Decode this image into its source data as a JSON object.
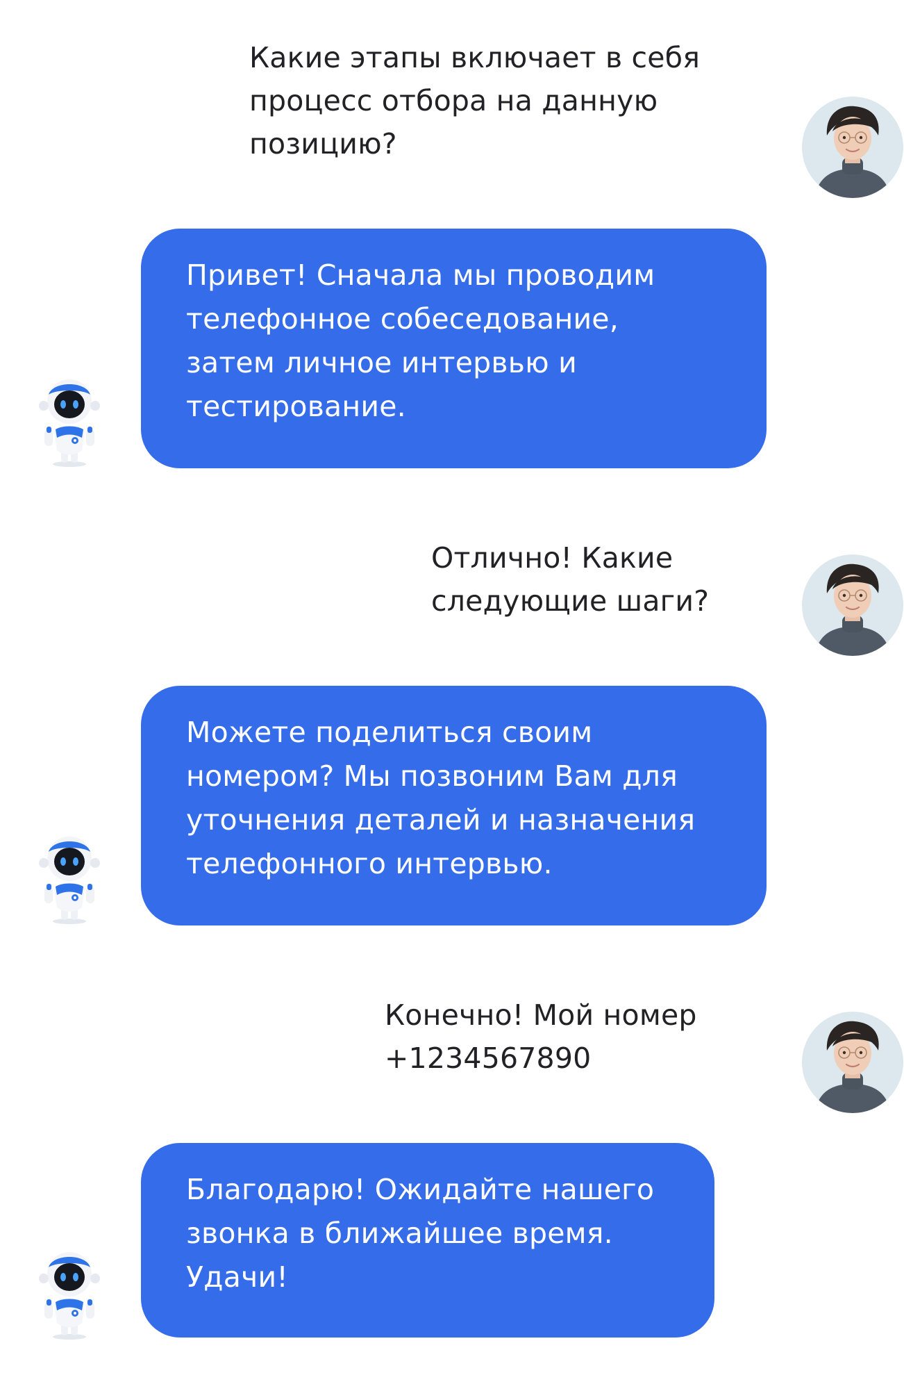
{
  "messages": [
    {
      "sender": "user",
      "text": "Какие этапы включает в себя\nпроцесс отбора на данную\nпозицию?"
    },
    {
      "sender": "bot",
      "text": "Привет! Сначала мы проводим\nтелефонное собеседование,\nзатем личное интервью и\nтестирование."
    },
    {
      "sender": "user",
      "text": "Отлично! Какие\nследующие шаги?"
    },
    {
      "sender": "bot",
      "text": "Можете поделиться своим\nномером? Мы позвоним Вам для\nуточнения деталей и назначения\nтелефонного интервью."
    },
    {
      "sender": "user",
      "text": "Конечно! Мой номер\n+1234567890"
    },
    {
      "sender": "bot",
      "text": "Благодарю! Ожидайте нашего\nзвонка в ближайшее время.\nУдачи!"
    }
  ],
  "avatars": {
    "user": "woman-avatar",
    "bot": "robot-avatar"
  },
  "colors": {
    "bubble": "#346CEA",
    "bubble_text": "#FFFFFF",
    "user_text": "#222226",
    "background": "#FFFFFF"
  }
}
